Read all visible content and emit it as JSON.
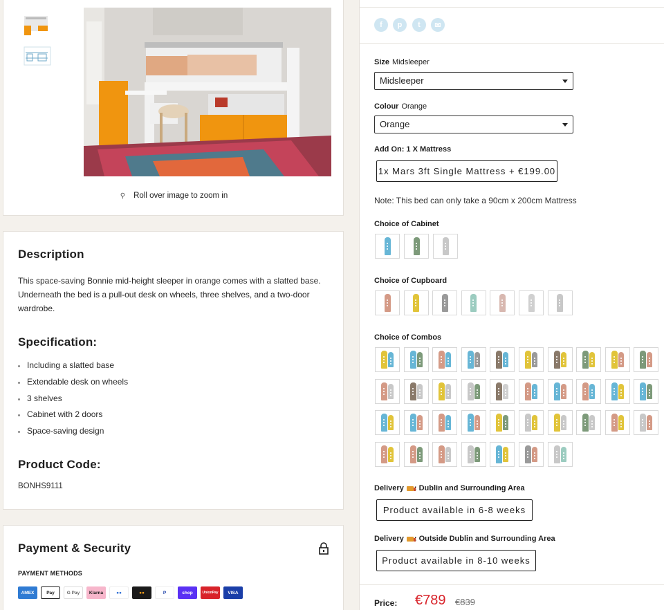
{
  "gallery": {
    "zoom_hint": "Roll over image to zoom in"
  },
  "description": {
    "heading": "Description",
    "body": "This space-saving Bonnie mid-height sleeper in orange comes with a slatted base. Underneath the bed is a pull-out desk on wheels, three shelves, and a two-door wardrobe.",
    "spec_heading": "Specification:",
    "specs": [
      "Including a slatted base",
      "Extendable desk on wheels",
      "3 shelves",
      "Cabinet with 2 doors",
      "Space-saving design"
    ],
    "code_heading": "Product Code:",
    "code": "BONHS9111"
  },
  "payment": {
    "heading": "Payment & Security",
    "methods_label": "PAYMENT METHODS",
    "methods": [
      {
        "name": "amex",
        "label": "AMEX",
        "color": "#2f7bd3"
      },
      {
        "name": "apple-pay",
        "label": "Pay",
        "color": "#ffffff"
      },
      {
        "name": "google-pay",
        "label": "G Pay",
        "color": "#ffffff"
      },
      {
        "name": "klarna",
        "label": "Klarna",
        "color": "#f7b6cb"
      },
      {
        "name": "maestro",
        "label": "●●",
        "color": "#ffffff"
      },
      {
        "name": "mastercard",
        "label": "●●",
        "color": "#1a1a1a"
      },
      {
        "name": "paypal",
        "label": "P",
        "color": "#ffffff"
      },
      {
        "name": "shop-pay",
        "label": "shop",
        "color": "#5a31f4"
      },
      {
        "name": "unionpay",
        "label": "UnionPay",
        "color": "#d8232a"
      },
      {
        "name": "visa",
        "label": "VISA",
        "color": "#1a3ea8"
      }
    ]
  },
  "social": [
    {
      "name": "facebook",
      "glyph": "f"
    },
    {
      "name": "pinterest",
      "glyph": "p"
    },
    {
      "name": "twitter",
      "glyph": "t"
    },
    {
      "name": "email",
      "glyph": "✉"
    }
  ],
  "options": {
    "size_label": "Size",
    "size_value": "Midsleeper",
    "size_selected": "Midsleeper",
    "colour_label": "Colour",
    "colour_value": "Orange",
    "colour_selected": "Orange",
    "addon_label": "Add On: 1 X Mattress",
    "addon_option": "1x Mars 3ft Single Mattress + €199.00",
    "note": "Note: This bed can only take a 90cm x 200cm Mattress",
    "cabinet_label": "Choice of Cabinet",
    "cupboard_label": "Choice of Cupboard",
    "combos_label": "Choice of Combos"
  },
  "swatches": {
    "cabinet": [
      "#67b6d6",
      "#7d9a7a",
      "#c8c8c8"
    ],
    "cupboard": [
      "#d49a86",
      "#e1c43a",
      "#9a9a9a",
      "#9cccc0",
      "#d8b8b0",
      "#d0d0d0",
      "#c8c8c8"
    ],
    "combos": [
      [
        "#e1c43a",
        "#67b6d6"
      ],
      [
        "#67b6d6",
        "#7d9a7a"
      ],
      [
        "#d49a86",
        "#67b6d6"
      ],
      [
        "#67b6d6",
        "#9a9a9a"
      ],
      [
        "#8a7a6a",
        "#67b6d6"
      ],
      [
        "#e1c43a",
        "#9a9a9a"
      ],
      [
        "#8a7a6a",
        "#e1c43a"
      ],
      [
        "#7d9a7a",
        "#e1c43a"
      ],
      [
        "#e1c43a",
        "#d49a86"
      ],
      [
        "#7d9a7a",
        "#d49a86"
      ],
      [
        "#d49a86",
        "#c8c8c8"
      ],
      [
        "#8a7a6a",
        "#c8c8c8"
      ],
      [
        "#e1c43a",
        "#c8c8c8"
      ],
      [
        "#c8c8c8",
        "#7d9a7a"
      ],
      [
        "#8a7a6a",
        "#d0d0d0"
      ],
      [
        "#d49a86",
        "#67b6d6"
      ],
      [
        "#67b6d6",
        "#d49a86"
      ],
      [
        "#d49a86",
        "#67b6d6"
      ],
      [
        "#67b6d6",
        "#e1c43a"
      ],
      [
        "#67b6d6",
        "#7d9a7a"
      ],
      [
        "#67b6d6",
        "#e1c43a"
      ],
      [
        "#67b6d6",
        "#d49a86"
      ],
      [
        "#d49a86",
        "#67b6d6"
      ],
      [
        "#67b6d6",
        "#d49a86"
      ],
      [
        "#e1c43a",
        "#7d9a7a"
      ],
      [
        "#c8c8c8",
        "#e1c43a"
      ],
      [
        "#e1c43a",
        "#c8c8c8"
      ],
      [
        "#7d9a7a",
        "#c8c8c8"
      ],
      [
        "#d49a86",
        "#e1c43a"
      ],
      [
        "#c8c8c8",
        "#d49a86"
      ],
      [
        "#d49a86",
        "#e1c43a"
      ],
      [
        "#d49a86",
        "#7d9a7a"
      ],
      [
        "#d49a86",
        "#c8c8c8"
      ],
      [
        "#c8c8c8",
        "#7d9a7a"
      ],
      [
        "#67b6d6",
        "#e1c43a"
      ],
      [
        "#9a9a9a",
        "#d49a86"
      ],
      [
        "#c8c8c8",
        "#9cccc0"
      ]
    ]
  },
  "delivery": {
    "dublin_label_pre": "Delivery",
    "dublin_label_post": ": Dublin and Surrounding Area",
    "dublin_value": "Product available in 6-8 weeks",
    "outside_label_pre": "Delivery",
    "outside_label_post": ": Outside Dublin and Surrounding Area",
    "outside_value": "Product available in 8-10 weeks"
  },
  "price": {
    "label": "Price:",
    "current": "€789",
    "original": "€839"
  },
  "colors": {
    "accent_orange": "#f0950f",
    "price_red": "#d8232a"
  }
}
